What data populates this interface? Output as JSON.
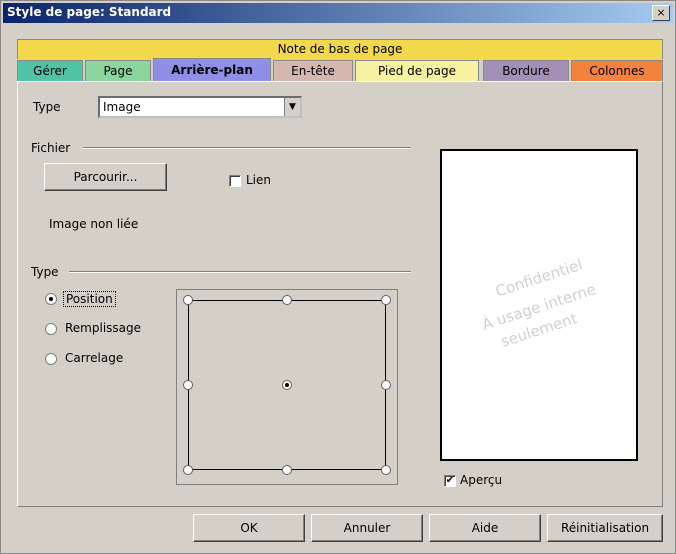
{
  "window": {
    "title": "Style de page: Standard",
    "close_glyph": "×"
  },
  "tabs_top": {
    "label": "Note de bas de page",
    "color": "#f2d84a"
  },
  "tabs": [
    {
      "label": "Gérer",
      "color": "#52c4a6"
    },
    {
      "label": "Page",
      "color": "#8ad69e"
    },
    {
      "label": "Arrière-plan",
      "color": "#8f8fe8"
    },
    {
      "label": "En-tête",
      "color": "#d4b8b0"
    },
    {
      "label": "Pied de page",
      "color": "#f7f2a0"
    },
    {
      "label": "Bordure",
      "color": "#a48fb6"
    },
    {
      "label": "Colonnes",
      "color": "#f2823c"
    }
  ],
  "type_row": {
    "label": "Type",
    "value": "Image"
  },
  "fichier": {
    "label": "Fichier",
    "browse_label": "Parcourir...",
    "link_label": "Lien",
    "link_checked": false,
    "status": "Image non liée"
  },
  "type_section": {
    "label": "Type",
    "options": [
      {
        "label": "Position",
        "selected": true
      },
      {
        "label": "Remplissage",
        "selected": false
      },
      {
        "label": "Carrelage",
        "selected": false
      }
    ]
  },
  "preview": {
    "lines": [
      "Confidentiel",
      "À usage interne",
      "seulement"
    ],
    "preview_label": "Aperçu",
    "preview_checked": true
  },
  "buttons": {
    "ok": "OK",
    "cancel": "Annuler",
    "help": "Aide",
    "reset": "Réinitialisation"
  }
}
